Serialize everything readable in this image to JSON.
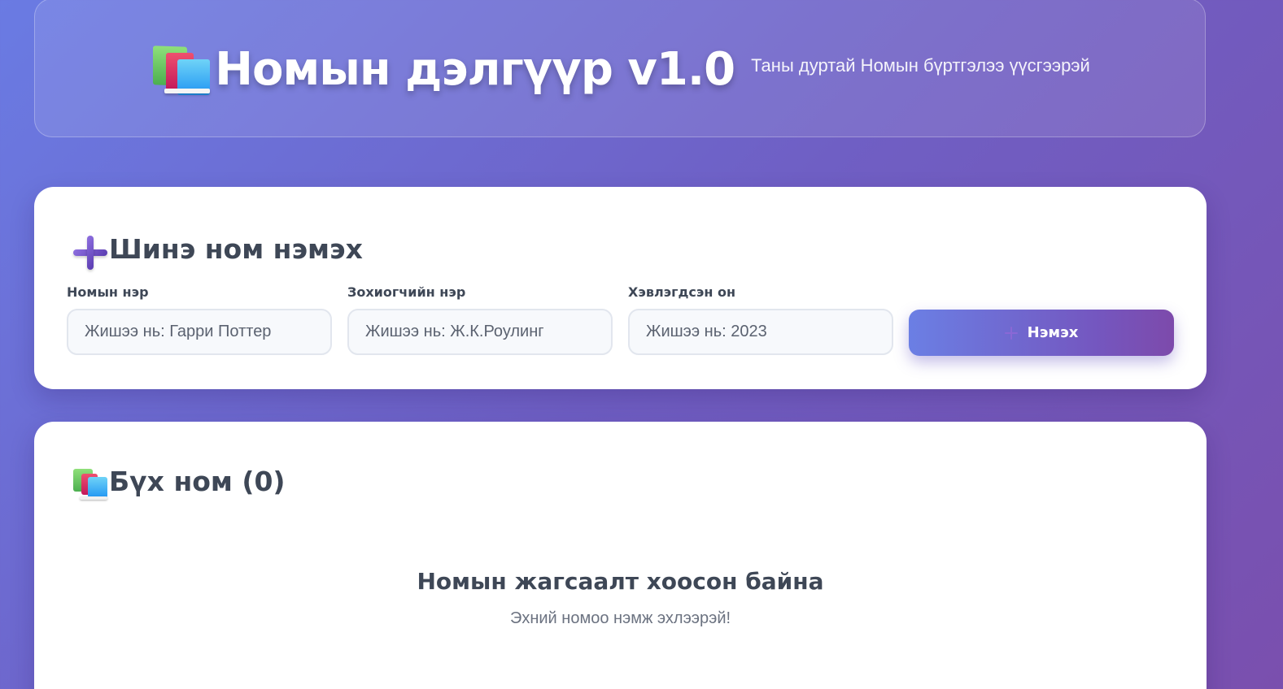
{
  "header": {
    "title": "Номын дэлгүүр v1.0",
    "subtitle": "Таны дуртай Номын бүртгэлээ үүсгээрэй",
    "icon": "books-icon"
  },
  "add_section": {
    "icon": "plus-icon",
    "title": "Шинэ ном нэмэх",
    "fields": [
      {
        "label": "Номын нэр",
        "placeholder": "Жишээ нь: Гарри Поттер",
        "value": ""
      },
      {
        "label": "Зохиогчийн нэр",
        "placeholder": "Жишээ нь: Ж.К.Роулинг",
        "value": ""
      },
      {
        "label": "Хэвлэгдсэн он",
        "placeholder": "Жишээ нь: 2023",
        "value": ""
      }
    ],
    "add_button_label": "Нэмэх",
    "add_button_icon": "plus-icon"
  },
  "list_section": {
    "icon": "books-icon",
    "title": "Бүх ном (0)",
    "empty_title": "Номын жагсаалт хоосон байна",
    "empty_subtitle": "Эхний номоо нэмж эхлээрэй!"
  },
  "colors": {
    "background_start": "#6a7be3",
    "background_end": "#7a4fae",
    "card": "#ffffff",
    "heading_text": "#3e4756",
    "muted_text": "#6b7280"
  }
}
